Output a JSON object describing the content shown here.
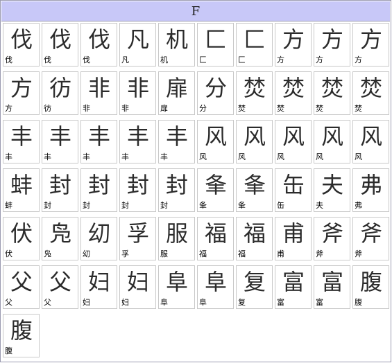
{
  "header": {
    "title": "F"
  },
  "cells": [
    {
      "glyph": "伐",
      "label": "伐"
    },
    {
      "glyph": "伐",
      "label": "伐"
    },
    {
      "glyph": "伐",
      "label": "伐"
    },
    {
      "glyph": "凡",
      "label": "凡"
    },
    {
      "glyph": "机",
      "label": "机"
    },
    {
      "glyph": "匚",
      "label": "匚"
    },
    {
      "glyph": "匚",
      "label": "匚"
    },
    {
      "glyph": "方",
      "label": "方"
    },
    {
      "glyph": "方",
      "label": "方"
    },
    {
      "glyph": "方",
      "label": "方"
    },
    {
      "glyph": "方",
      "label": "方"
    },
    {
      "glyph": "彷",
      "label": "彷"
    },
    {
      "glyph": "非",
      "label": "非"
    },
    {
      "glyph": "非",
      "label": "非"
    },
    {
      "glyph": "扉",
      "label": "扉"
    },
    {
      "glyph": "分",
      "label": "分"
    },
    {
      "glyph": "焚",
      "label": "焚"
    },
    {
      "glyph": "焚",
      "label": "焚"
    },
    {
      "glyph": "焚",
      "label": "焚"
    },
    {
      "glyph": "焚",
      "label": "焚"
    },
    {
      "glyph": "丰",
      "label": "丰"
    },
    {
      "glyph": "丰",
      "label": "丰"
    },
    {
      "glyph": "丰",
      "label": "丰"
    },
    {
      "glyph": "丰",
      "label": "丰"
    },
    {
      "glyph": "丰",
      "label": "丰"
    },
    {
      "glyph": "风",
      "label": "风"
    },
    {
      "glyph": "风",
      "label": "风"
    },
    {
      "glyph": "风",
      "label": "风"
    },
    {
      "glyph": "风",
      "label": "风"
    },
    {
      "glyph": "风",
      "label": "风"
    },
    {
      "glyph": "蚌",
      "label": "蚌"
    },
    {
      "glyph": "封",
      "label": "封"
    },
    {
      "glyph": "封",
      "label": "封"
    },
    {
      "glyph": "封",
      "label": "封"
    },
    {
      "glyph": "封",
      "label": "封"
    },
    {
      "glyph": "夆",
      "label": "夆"
    },
    {
      "glyph": "夆",
      "label": "夆"
    },
    {
      "glyph": "缶",
      "label": "缶"
    },
    {
      "glyph": "夫",
      "label": "夫"
    },
    {
      "glyph": "弗",
      "label": "弗"
    },
    {
      "glyph": "伏",
      "label": "伏"
    },
    {
      "glyph": "凫",
      "label": "凫"
    },
    {
      "glyph": "㓜",
      "label": "㓜"
    },
    {
      "glyph": "孚",
      "label": "孚"
    },
    {
      "glyph": "服",
      "label": "服"
    },
    {
      "glyph": "福",
      "label": "福"
    },
    {
      "glyph": "福",
      "label": "福"
    },
    {
      "glyph": "甫",
      "label": "甫"
    },
    {
      "glyph": "斧",
      "label": "斧"
    },
    {
      "glyph": "斧",
      "label": "斧"
    },
    {
      "glyph": "父",
      "label": "父"
    },
    {
      "glyph": "父",
      "label": "父"
    },
    {
      "glyph": "妇",
      "label": "妇"
    },
    {
      "glyph": "妇",
      "label": "妇"
    },
    {
      "glyph": "阜",
      "label": "阜"
    },
    {
      "glyph": "阜",
      "label": "阜"
    },
    {
      "glyph": "复",
      "label": "复"
    },
    {
      "glyph": "富",
      "label": "富"
    },
    {
      "glyph": "富",
      "label": "富"
    },
    {
      "glyph": "腹",
      "label": "腹"
    },
    {
      "glyph": "腹",
      "label": "腹"
    }
  ]
}
